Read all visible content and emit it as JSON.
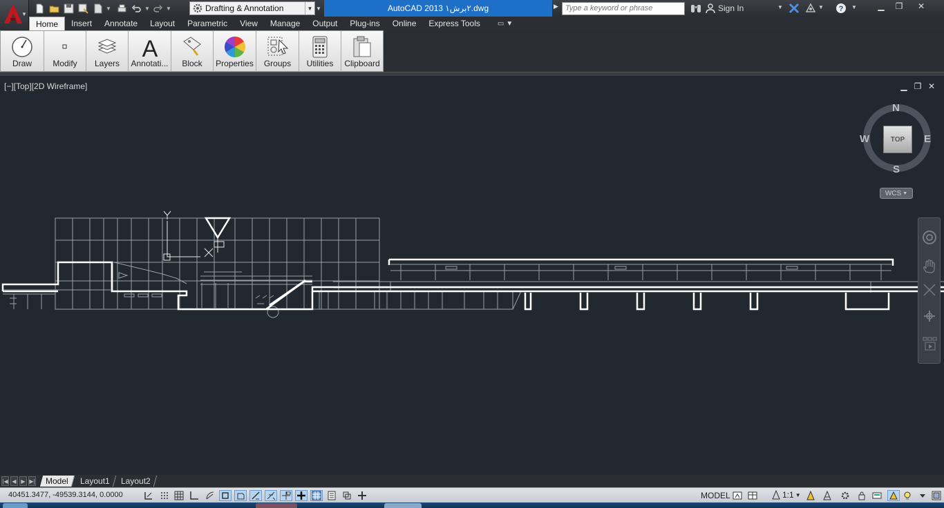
{
  "window": {
    "title": "AutoCAD 2013   ٢برش١.dwg",
    "workspace": "Drafting & Annotation",
    "search_placeholder": "Type a keyword or phrase",
    "sign_in": "Sign In"
  },
  "ribbon": {
    "tabs": [
      {
        "label": "Home",
        "active": true
      },
      {
        "label": "Insert"
      },
      {
        "label": "Annotate"
      },
      {
        "label": "Layout"
      },
      {
        "label": "Parametric"
      },
      {
        "label": "View"
      },
      {
        "label": "Manage"
      },
      {
        "label": "Output"
      },
      {
        "label": "Plug-ins"
      },
      {
        "label": "Online"
      },
      {
        "label": "Express Tools"
      }
    ],
    "panels": [
      {
        "label": "Draw",
        "icon": "draw-circle-icon"
      },
      {
        "label": "Modify",
        "icon": "modify-icon"
      },
      {
        "label": "Layers",
        "icon": "layers-icon"
      },
      {
        "label": "Annotati...",
        "icon": "annotation-text-icon"
      },
      {
        "label": "Block",
        "icon": "block-icon"
      },
      {
        "label": "Properties",
        "icon": "color-wheel-icon"
      },
      {
        "label": "Groups",
        "icon": "groups-icon"
      },
      {
        "label": "Utilities",
        "icon": "calculator-icon"
      },
      {
        "label": "Clipboard",
        "icon": "clipboard-icon"
      }
    ]
  },
  "viewport": {
    "label": "[−][Top][2D Wireframe]",
    "viewcube": {
      "top": "TOP",
      "north": "N",
      "south": "S",
      "east": "E",
      "west": "W",
      "wcs": "WCS"
    }
  },
  "layout_tabs": [
    {
      "label": "Model",
      "active": true
    },
    {
      "label": "Layout1"
    },
    {
      "label": "Layout2"
    }
  ],
  "status": {
    "coords": "40451.3477, -49539.3144, 0.0000",
    "model": "MODEL",
    "scale": "1:1"
  },
  "colors": {
    "accent": "#1e6fc7",
    "viewport_bg": "#212830",
    "drawing_line": "#ffffff"
  }
}
